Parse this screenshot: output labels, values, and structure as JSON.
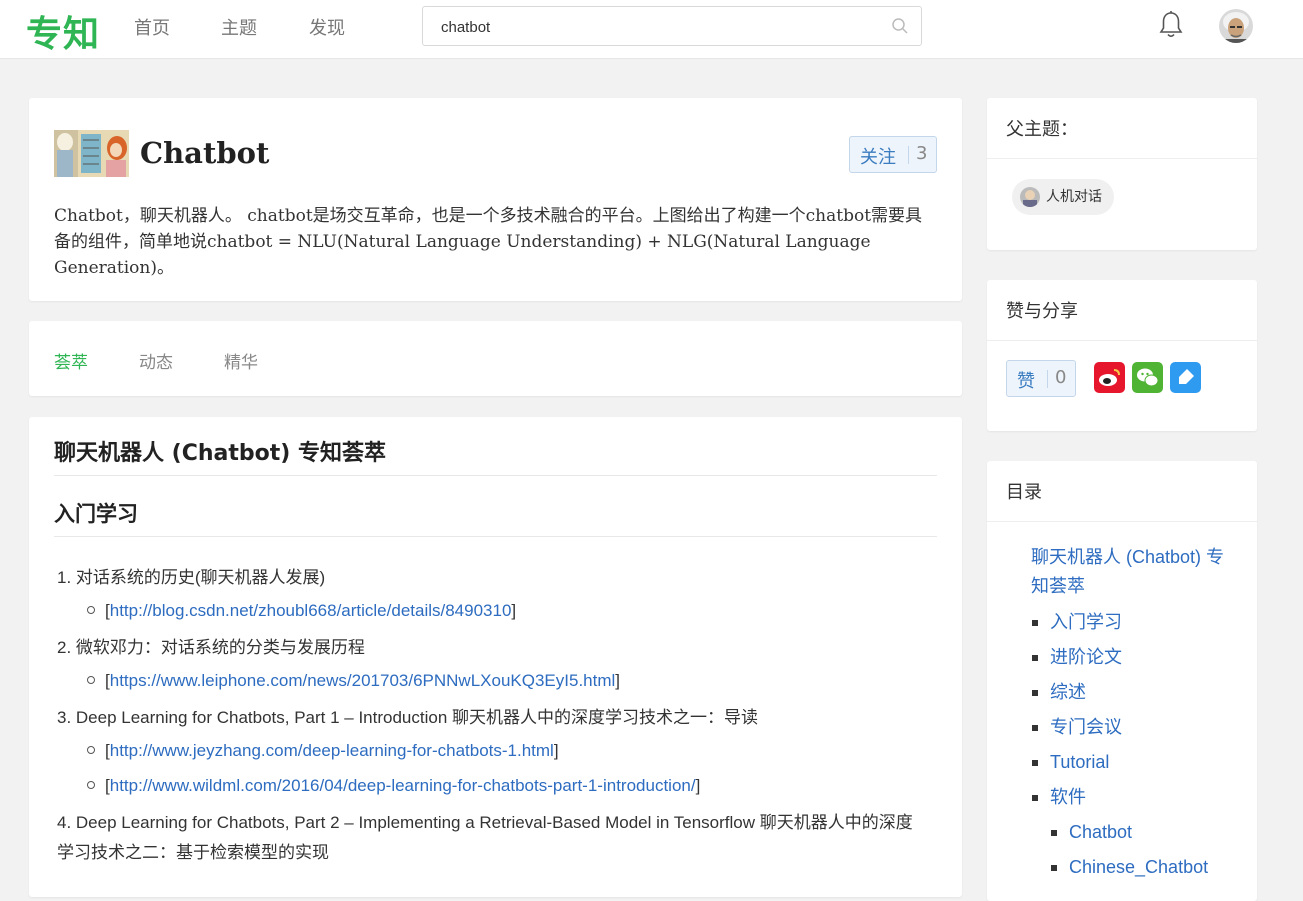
{
  "header": {
    "logo": "专知",
    "nav": [
      "首页",
      "主题",
      "发现"
    ],
    "search": {
      "value": "chatbot",
      "placeholder": ""
    }
  },
  "topic": {
    "title": "Chatbot",
    "follow_label": "关注",
    "follow_count": "3",
    "description": "Chatbot，聊天机器人。 chatbot是场交互革命，也是一个多技术融合的平台。上图给出了构建一个chatbot需要具备的组件，简单地说chatbot = NLU(Natural Language Understanding) + NLG(Natural Language Generation)。"
  },
  "tabs": [
    {
      "label": "荟萃",
      "active": true
    },
    {
      "label": "动态",
      "active": false
    },
    {
      "label": "精华",
      "active": false
    }
  ],
  "content": {
    "title": "聊天机器人 (Chatbot) 专知荟萃",
    "section": "入门学习",
    "items": [
      {
        "text": "1. 对话系统的历史(聊天机器人发展)",
        "links": [
          "http://blog.csdn.net/zhoubl668/article/details/8490310"
        ]
      },
      {
        "text": "2. 微软邓力：对话系统的分类与发展历程",
        "links": [
          "https://www.leiphone.com/news/201703/6PNNwLXouKQ3EyI5.html"
        ]
      },
      {
        "text": "3. Deep Learning for Chatbots, Part 1 – Introduction 聊天机器人中的深度学习技术之一：导读",
        "links": [
          "http://www.jeyzhang.com/deep-learning-for-chatbots-1.html",
          "http://www.wildml.com/2016/04/deep-learning-for-chatbots-part-1-introduction/"
        ]
      },
      {
        "text": "4. Deep Learning for Chatbots, Part 2 – Implementing a Retrieval-Based Model in Tensorflow 聊天机器人中的深度学习技术之二：基于检索模型的实现",
        "links": []
      }
    ],
    "bracket_open": "[",
    "bracket_close": "]"
  },
  "sidebar": {
    "parent_heading": "父主题：",
    "parent_topic": "人机对话",
    "share_heading": "赞与分享",
    "like_label": "赞",
    "like_count": "0",
    "toc_heading": "目录",
    "toc": {
      "root": "聊天机器人 (Chatbot) 专知荟萃",
      "level1": [
        "入门学习",
        "进阶论文",
        "综述",
        "专门会议",
        "Tutorial",
        "软件"
      ],
      "level2": [
        "Chatbot",
        "Chinese_Chatbot"
      ]
    }
  },
  "colors": {
    "brand": "#2fb553",
    "link": "#2d6cc0",
    "weibo": "#e6162d",
    "wechat": "#4fb334",
    "qzone": "#2f9bf0"
  }
}
